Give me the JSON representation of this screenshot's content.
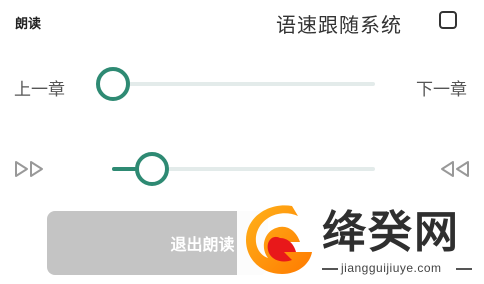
{
  "header": {
    "title": "朗读",
    "follow_speed_label": "语速跟随系统",
    "follow_speed_checked": false
  },
  "chapter": {
    "prev_label": "上一章",
    "next_label": "下一章",
    "progress": 0
  },
  "speed": {
    "down_icon": "double-triangle-right-outline",
    "up_icon": "double-triangle-left-outline",
    "level": 0.15
  },
  "exit_button": {
    "label": "退出朗读"
  },
  "watermark": {
    "title": "绛癸网",
    "url": "jiangguijiuye.com"
  },
  "colors": {
    "accent": "#2e8a73",
    "track": "#e3ebea",
    "button_disabled": "#c4c4c4"
  }
}
